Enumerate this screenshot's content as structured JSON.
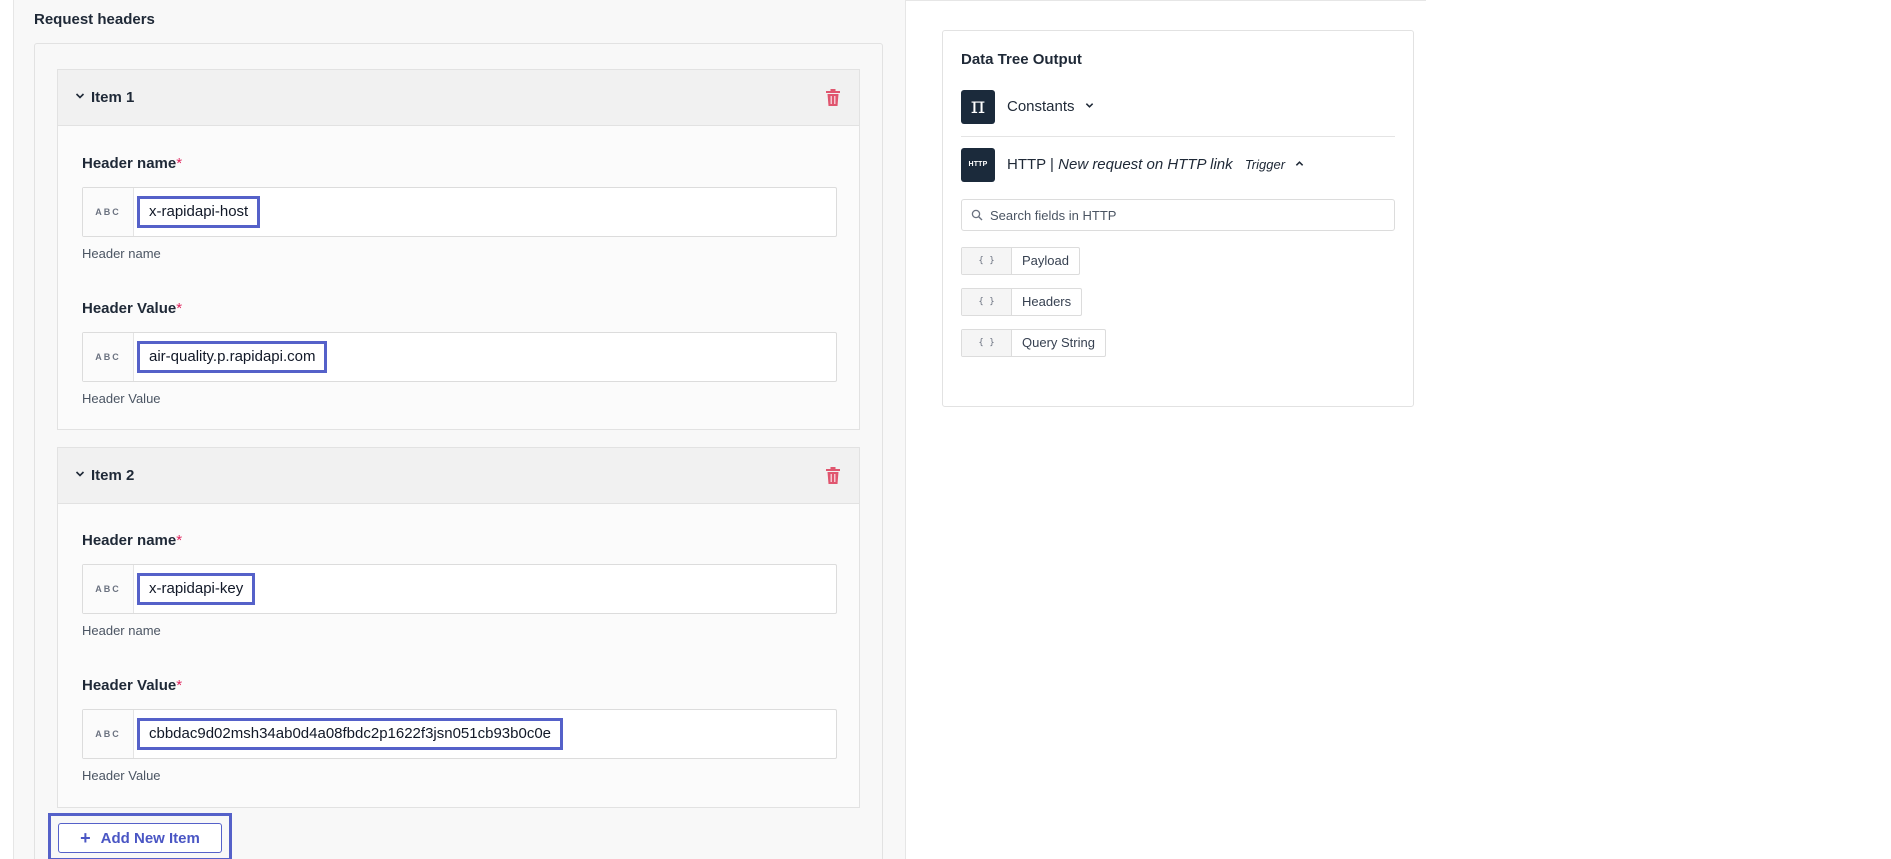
{
  "request_headers": {
    "title": "Request headers",
    "items": [
      {
        "title": "Item 1",
        "header_name_label": "Header name",
        "header_name_value": "x-rapidapi-host",
        "header_name_help": "Header name",
        "header_value_label": "Header Value",
        "header_value_value": "air-quality.p.rapidapi.com",
        "header_value_help": "Header Value",
        "type_badge": "ABC"
      },
      {
        "title": "Item 2",
        "header_name_label": "Header name",
        "header_name_value": "x-rapidapi-key",
        "header_name_help": "Header name",
        "header_value_label": "Header Value",
        "header_value_value": "cbbdac9d02msh34ab0d4a08fbdc2p1622f3jsn051cb93b0c0e",
        "header_value_help": "Header Value",
        "type_badge": "ABC"
      }
    ],
    "required_mark": "*",
    "add_button_label": "Add New Item"
  },
  "data_tree": {
    "title": "Data Tree Output",
    "constants": {
      "icon": "pi-icon",
      "icon_glyph": "π",
      "label": "Constants"
    },
    "http": {
      "icon": "http-icon",
      "icon_text": "HTTP",
      "app": "HTTP |",
      "event": "New request on HTTP link",
      "badge": "Trigger"
    },
    "search_placeholder": "Search fields in HTTP",
    "fields": [
      {
        "icon": "{ }",
        "label": "Payload"
      },
      {
        "icon": "{ }",
        "label": "Headers"
      },
      {
        "icon": "{ }",
        "label": "Query String"
      }
    ]
  },
  "colors": {
    "accent": "#5561c9",
    "required": "#e0245e",
    "trash": "#e0566f",
    "dark_icon": "#1b2a3b"
  }
}
